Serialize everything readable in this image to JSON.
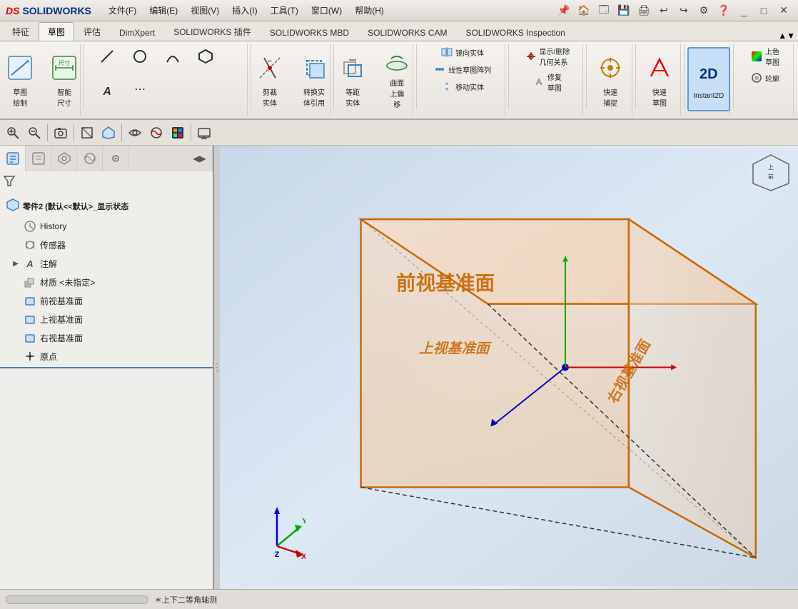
{
  "app": {
    "title": "SolidWorks",
    "logo_ds": "DS",
    "logo_sw": "SOLIDWORKS"
  },
  "titlebar": {
    "menus": [
      "文件(F)",
      "编辑(E)",
      "视图(V)",
      "插入(I)",
      "工具(T)",
      "窗口(W)",
      "帮助(H)"
    ],
    "pin_icon": "📌"
  },
  "ribbon_tabs": [
    "特征",
    "草图",
    "评估",
    "DimXpert",
    "SOLIDWORKS 插件",
    "SOLIDWORKS MBD",
    "SOLIDWORKS CAM",
    "SOLIDWORKS Inspection"
  ],
  "active_tab": "草图",
  "ribbon": {
    "groups": [
      {
        "label": "",
        "buttons": [
          {
            "icon": "✏️",
            "label": "草图\n绘制"
          },
          {
            "icon": "📐",
            "label": "智能\n尺寸"
          }
        ]
      },
      {
        "label": "",
        "buttons": [
          {
            "icon": "╱",
            "label": ""
          },
          {
            "icon": "⬡",
            "label": ""
          },
          {
            "icon": "Ⓐ",
            "label": ""
          }
        ]
      },
      {
        "label": "",
        "buttons": [
          {
            "icon": "✂️",
            "label": "剪裁\n实体"
          },
          {
            "icon": "🔄",
            "label": "转换实\n体引用"
          }
        ]
      },
      {
        "label": "",
        "buttons": [
          {
            "icon": "⟺",
            "label": "等距\n实体"
          },
          {
            "icon": "🔄",
            "label": "曲面\n上偏\n移"
          }
        ]
      },
      {
        "label": "",
        "buttons": [
          {
            "icon": "⫶",
            "label": "线性草图阵列"
          },
          {
            "icon": "↔",
            "label": "镜向实体"
          },
          {
            "icon": "⤢",
            "label": "移动实体"
          }
        ]
      },
      {
        "label": "",
        "buttons": [
          {
            "icon": "👁",
            "label": "显示/删除\n几何关系"
          },
          {
            "icon": "🔧",
            "label": "修复\n草图"
          }
        ]
      },
      {
        "label": "",
        "buttons": [
          {
            "icon": "🔍",
            "label": "快速\n捕捉"
          }
        ]
      },
      {
        "label": "",
        "buttons": [
          {
            "icon": "⚡",
            "label": "快速\n草图"
          }
        ]
      },
      {
        "label": "Instant2D",
        "active": true,
        "buttons": [
          {
            "icon": "2D",
            "label": "Instant2D"
          }
        ]
      },
      {
        "label": "",
        "buttons": [
          {
            "icon": "🎨",
            "label": "上色\n草图"
          },
          {
            "icon": "📷",
            "label": "轮廓"
          }
        ]
      }
    ]
  },
  "view_toolbar": {
    "buttons": [
      "🔍",
      "🔍",
      "📷",
      "⬜",
      "🔺",
      "👁",
      "🎨",
      "⬛",
      "🖥"
    ]
  },
  "sidebar": {
    "tabs": [
      {
        "icon": "🔧",
        "label": "feature-tab"
      },
      {
        "icon": "📋",
        "label": "property-tab"
      },
      {
        "icon": "📁",
        "label": "config-tab"
      },
      {
        "icon": "🎨",
        "label": "appearance-tab"
      },
      {
        "icon": "◉",
        "label": "view-tab"
      }
    ],
    "part_name": "零件2 (默认<<默认>_显示状态",
    "tree_items": [
      {
        "icon": "⏱",
        "label": "History",
        "indent": 1
      },
      {
        "icon": "⚙",
        "label": "传感器",
        "indent": 1
      },
      {
        "icon": "Ⓐ",
        "label": "注解",
        "indent": 1,
        "expand": true
      },
      {
        "icon": "⬡",
        "label": "材质 <未指定>",
        "indent": 1
      },
      {
        "icon": "◧",
        "label": "前视基准面",
        "indent": 1
      },
      {
        "icon": "◧",
        "label": "上视基准面",
        "indent": 1
      },
      {
        "icon": "◧",
        "label": "右视基准面",
        "indent": 1
      },
      {
        "icon": "↕",
        "label": "原点",
        "indent": 1
      }
    ]
  },
  "viewport": {
    "plane_labels": {
      "front": "前视基准面",
      "top": "上视基准面",
      "right": "右视基准面"
    }
  },
  "statusbar": {
    "text": "＊上下二等角轴测"
  }
}
